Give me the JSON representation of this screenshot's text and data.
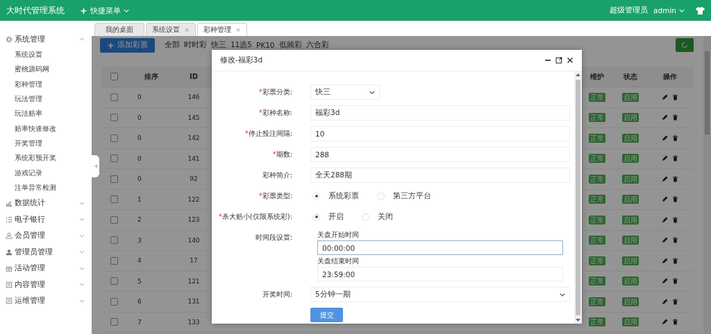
{
  "header": {
    "title": "大时代管理系统",
    "quick_menu": {
      "plus": "+",
      "label": "快捷菜单"
    },
    "role": "超级管理员",
    "user": "admin"
  },
  "sidebar": {
    "groups": [
      {
        "label": "系统管理",
        "expanded": true,
        "children": [
          "系统设置",
          "蜜桃源码网",
          "彩种管理",
          "玩法管理",
          "玩法赔率",
          "赔率快速修改",
          "开奖管理",
          "系统彩预开奖",
          "游戏记录",
          "注单异常检测"
        ]
      },
      {
        "label": "数据统计",
        "expanded": false
      },
      {
        "label": "电子银行",
        "expanded": false
      },
      {
        "label": "会员管理",
        "expanded": false
      },
      {
        "label": "管理员管理",
        "expanded": false
      },
      {
        "label": "活动管理",
        "expanded": false
      },
      {
        "label": "内容管理",
        "expanded": false
      },
      {
        "label": "运维管理",
        "expanded": false
      }
    ]
  },
  "tabs": [
    {
      "label": "我的桌面",
      "selected": false
    },
    {
      "label": "系统设置",
      "selected": false,
      "close": "×"
    },
    {
      "label": "彩种管理",
      "selected": true,
      "close": "×"
    }
  ],
  "toolbar": {
    "add_button": {
      "plus": "+",
      "label": "添加彩票"
    },
    "filters": [
      "全部",
      "时时彩",
      "快三",
      "11选5",
      "PK10",
      "低频彩",
      "六合彩"
    ]
  },
  "table": {
    "select_all_checked": false,
    "columns": [
      "排序",
      "ID",
      "维护",
      "状态",
      "操作"
    ],
    "rows": [
      {
        "checked": false,
        "sort": "0",
        "id": "146",
        "maintenance": "正常",
        "status": "启用"
      },
      {
        "checked": false,
        "sort": "0",
        "id": "145",
        "maintenance": "正常",
        "status": "启用"
      },
      {
        "checked": false,
        "sort": "0",
        "id": "142",
        "maintenance": "正常",
        "status": "启用"
      },
      {
        "checked": false,
        "sort": "0",
        "id": "141",
        "maintenance": "正常",
        "status": "启用"
      },
      {
        "checked": false,
        "sort": "0",
        "id": "92",
        "maintenance": "正常",
        "status": "启用"
      },
      {
        "checked": false,
        "sort": "1",
        "id": "122",
        "maintenance": "正常",
        "status": "启用"
      },
      {
        "checked": false,
        "sort": "2",
        "id": "123",
        "maintenance": "正常",
        "status": "启用"
      },
      {
        "checked": false,
        "sort": "3",
        "id": "140",
        "maintenance": "正常",
        "status": "启用"
      },
      {
        "checked": false,
        "sort": "4",
        "id": "17",
        "maintenance": "正常",
        "status": "启用"
      },
      {
        "checked": false,
        "sort": "5",
        "id": "121",
        "maintenance": "正常",
        "status": "启用"
      },
      {
        "checked": false,
        "sort": "6",
        "id": "131",
        "maintenance": "正常",
        "status": "启用"
      },
      {
        "checked": false,
        "sort": "7",
        "id": "133",
        "maintenance": "正常",
        "status": "启用"
      }
    ]
  },
  "dialog": {
    "title": "修改-福彩3d",
    "fields": [
      {
        "kind": "select",
        "required_mark": "*",
        "label": "彩票分类:",
        "value": "快三"
      },
      {
        "kind": "input",
        "required_mark": "*",
        "label": "彩种名称:",
        "value": "福彩3d"
      },
      {
        "kind": "input",
        "required_mark": "*",
        "label": "停止投注间隔:",
        "value": "10"
      },
      {
        "kind": "input",
        "required_mark": "*",
        "label": "期数:",
        "value": "288"
      },
      {
        "kind": "input",
        "label": "彩种简介:",
        "value": "全天288期"
      },
      {
        "kind": "radio",
        "required_mark": "*",
        "label": "彩票类型:",
        "options": [
          {
            "label": "系统彩票",
            "selected": true
          },
          {
            "label": "第三方平台",
            "selected": false
          }
        ]
      },
      {
        "kind": "radio",
        "required_mark": "*",
        "label": "杀大赔小(仅限系统彩):",
        "options": [
          {
            "label": "开启",
            "selected": true
          },
          {
            "label": "关闭",
            "selected": false
          }
        ]
      },
      {
        "kind": "timerange",
        "label": "时间段设置:",
        "start_label": "关盘开始时间",
        "start_value": "00:00:00",
        "end_label": "关盘结束时间",
        "end_value": "23:59:00"
      },
      {
        "kind": "select",
        "label": "开奖时间:",
        "value": "5分钟一期"
      }
    ],
    "submit": "提交"
  }
}
